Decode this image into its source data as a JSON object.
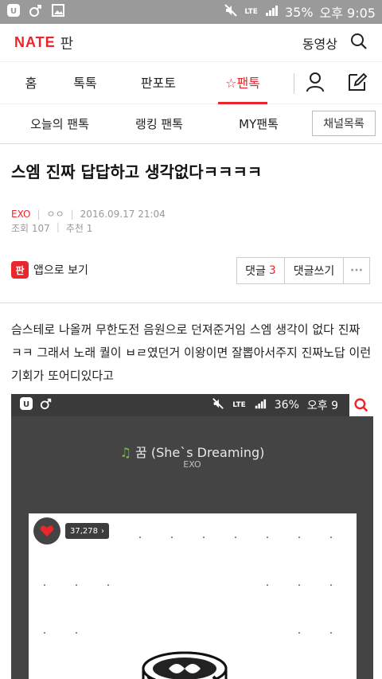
{
  "status_bar": {
    "battery": "35%",
    "time": "오후 9:05",
    "network": "LTE"
  },
  "header": {
    "logo": "NATE",
    "logo_sub": "판",
    "video_link": "동영상"
  },
  "tabs": [
    {
      "label": "홈"
    },
    {
      "label": "톡톡"
    },
    {
      "label": "판포토"
    },
    {
      "label": "☆팬톡",
      "active": true
    }
  ],
  "subtabs": [
    {
      "label": "오늘의 팬톡"
    },
    {
      "label": "랭킹 팬톡"
    },
    {
      "label": "MY팬톡"
    }
  ],
  "channel_button": "채널목록",
  "post": {
    "title": "스엠 진짜 답답하고 생각없다ㅋㅋㅋㅋ",
    "author": "EXO",
    "author_sub": "ㅇㅇ",
    "date": "2016.09.17 21:04",
    "views": "조회 107",
    "recommends": "추천 1",
    "body": "슴스테로 나올꺼 무한도전 음원으로 던져준거임 스엠 생각이 없다 진짜 ㅋㅋ 그래서 노래 퀄이 ㅂㄹ였던거 이왕이면 잘뽑아서주지 진짜노답 이런기회가 또어디있다고"
  },
  "actions": {
    "app_icon": "판",
    "app_view": "앱으로 보기",
    "comments_label": "댓글",
    "comments_count": "3",
    "write_comment": "댓글쓰기",
    "more": "···"
  },
  "embedded_screenshot": {
    "battery": "36%",
    "time": "오후 9",
    "network": "LTE",
    "song_title": "꿈 (She`s Dreaming)",
    "artist": "EXO",
    "like_count": "37,278",
    "like_chevron": "›"
  },
  "colors": {
    "accent": "#e8262b",
    "status_bar": "#9a9a9a"
  }
}
